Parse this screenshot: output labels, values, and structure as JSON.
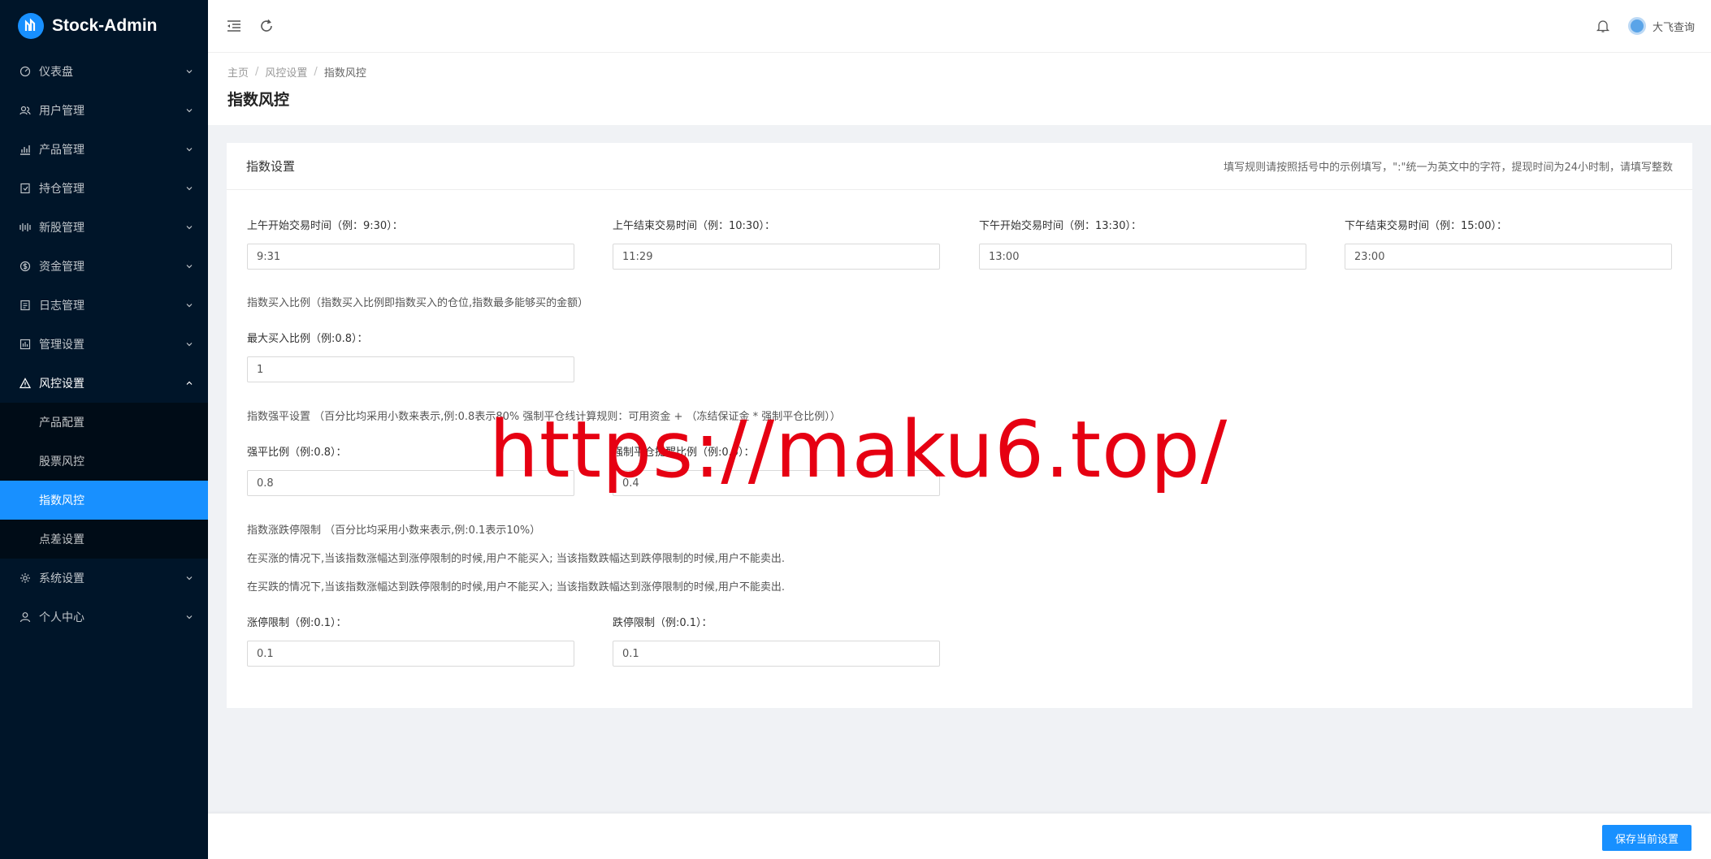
{
  "app": {
    "title": "Stock-Admin"
  },
  "sidebar": {
    "items": [
      {
        "label": "仪表盘",
        "icon": "dashboard-icon"
      },
      {
        "label": "用户管理",
        "icon": "users-icon"
      },
      {
        "label": "产品管理",
        "icon": "bar-chart-icon"
      },
      {
        "label": "持仓管理",
        "icon": "holdings-icon"
      },
      {
        "label": "新股管理",
        "icon": "ipo-icon"
      },
      {
        "label": "资金管理",
        "icon": "money-icon"
      },
      {
        "label": "日志管理",
        "icon": "log-icon"
      },
      {
        "label": "管理设置",
        "icon": "admin-settings-icon"
      },
      {
        "label": "风控设置",
        "icon": "warning-icon"
      },
      {
        "label": "系统设置",
        "icon": "gear-icon"
      },
      {
        "label": "个人中心",
        "icon": "user-icon"
      }
    ],
    "risk_sub": [
      {
        "label": "产品配置"
      },
      {
        "label": "股票风控"
      },
      {
        "label": "指数风控"
      },
      {
        "label": "点差设置"
      }
    ]
  },
  "header": {
    "user_name": "大飞查询"
  },
  "breadcrumb": {
    "home": "主页",
    "parent": "风控设置",
    "current": "指数风控"
  },
  "page": {
    "title": "指数风控"
  },
  "card": {
    "title": "指数设置",
    "note": "填写规则请按照括号中的示例填写，\":\"统一为英文中的字符，提现时间为24小时制，请填写整数"
  },
  "form": {
    "am_start_label": "上午开始交易时间（例：9:30）：",
    "am_start_value": "9:31",
    "am_end_label": "上午结束交易时间（例：10:30）：",
    "am_end_value": "11:29",
    "pm_start_label": "下午开始交易时间（例：13:30）：",
    "pm_start_value": "13:00",
    "pm_end_label": "下午结束交易时间（例：15:00）：",
    "pm_end_value": "23:00",
    "buy_ratio_hint": "指数买入比例（指数买入比例即指数买入的仓位,指数最多能够买的金额）",
    "max_buy_label": "最大买入比例（例:0.8）：",
    "max_buy_value": "1",
    "force_hint": "指数强平设置 （百分比均采用小数来表示,例:0.8表示80% 强制平仓线计算规则：可用资金 + （冻结保证金 * 强制平仓比例））",
    "force_ratio_label": "强平比例（例:0.8）：",
    "force_ratio_value": "0.8",
    "force_warn_label": "强制平仓提醒比例（例:0.5）：",
    "force_warn_value": "0.4",
    "limit_hint": "指数涨跌停限制 （百分比均采用小数来表示,例:0.1表示10%）",
    "limit_rule_1": "在买涨的情况下,当该指数涨幅达到涨停限制的时候,用户不能买入; 当该指数跌幅达到跌停限制的时候,用户不能卖出.",
    "limit_rule_2": "在买跌的情况下,当该指数涨幅达到跌停限制的时候,用户不能买入; 当该指数跌幅达到涨停限制的时候,用户不能卖出.",
    "limit_up_label": "涨停限制（例:0.1）：",
    "limit_up_value": "0.1",
    "limit_down_label": "跌停限制（例:0.1）：",
    "limit_down_value": "0.1"
  },
  "footer": {
    "save_label": "保存当前设置"
  },
  "watermark": "https://maku6.top/",
  "colors": {
    "accent": "#1890ff",
    "sidebar_bg": "#001529",
    "watermark": "#e60012"
  }
}
